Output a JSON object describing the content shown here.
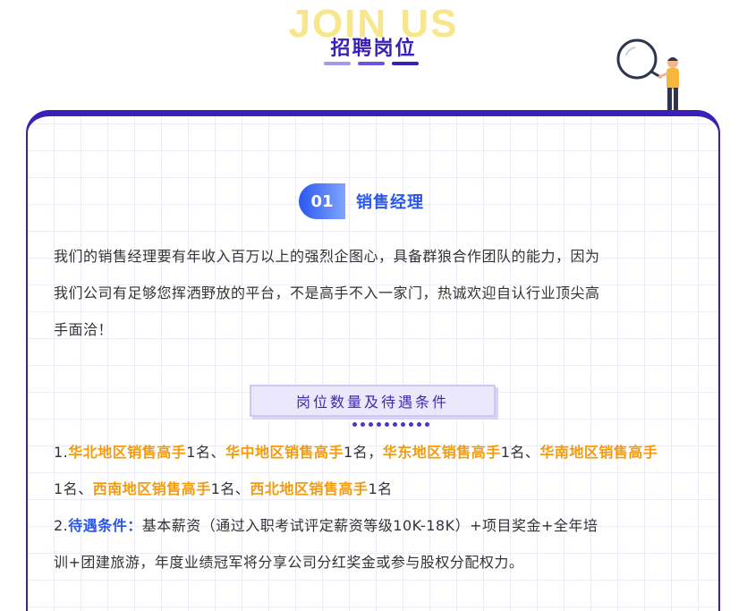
{
  "header": {
    "watermark": "JOIN US",
    "title": "招聘岗位"
  },
  "section": {
    "number": "01",
    "name": "销售经理",
    "description_lines": [
      "我们的销售经理要有年收入百万以上的强烈企图心，具备群狼合作团队的能力，因为",
      "我们公司有足够您挥洒野放的平台，不是高手不入一家门，热诚欢迎自认行业顶尖高",
      "手面洽！"
    ]
  },
  "tag": {
    "label": "岗位数量及待遇条件"
  },
  "positions": {
    "prefix": "1.",
    "items": [
      {
        "region": "华北地区销售高手",
        "count": "1名",
        "sep": "、"
      },
      {
        "region": "华中地区销售高手",
        "count": "1名",
        "sep": "，"
      },
      {
        "region": "华东地区销售高手",
        "count": "1名",
        "sep": "、"
      },
      {
        "region": "华南地区销售高手",
        "count": "1名",
        "sep": "、"
      },
      {
        "region": "西南地区销售高手",
        "count": "1名",
        "sep": "、"
      },
      {
        "region": "西北地区销售高手",
        "count": "1名",
        "sep": ""
      }
    ]
  },
  "benefits": {
    "prefix": "2.",
    "label": "待遇条件：",
    "line1": "基本薪资（通过入职考试评定薪资等级10K-18K）+项目奖金+全年培",
    "line2": "训+团建旅游，年度业绩冠军将分享公司分红奖金或参与股权分配权力。"
  },
  "colors": {
    "brand_purple": "#3b1fb8",
    "accent_blue": "#2a57e6",
    "highlight_orange": "#f39a0d",
    "watermark_yellow": "#f7e27a"
  }
}
